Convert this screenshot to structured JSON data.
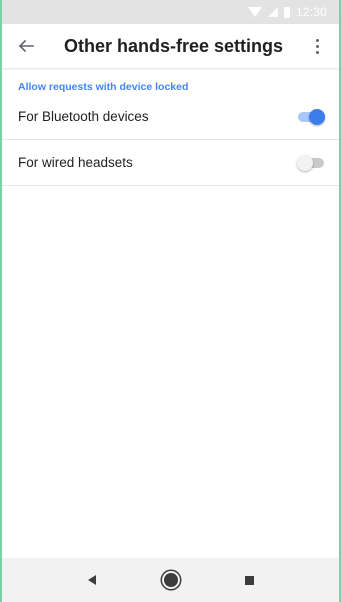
{
  "status_bar": {
    "time": "12:30",
    "icons": [
      "wifi-icon",
      "signal-icon",
      "battery-icon"
    ]
  },
  "app_bar": {
    "title": "Other hands-free settings",
    "back_icon": "arrow-back-icon",
    "more_icon": "more-vert-icon"
  },
  "section": {
    "header": "Allow requests with device locked",
    "items": [
      {
        "label": "For Bluetooth devices",
        "toggle_on": true
      },
      {
        "label": "For wired headsets",
        "toggle_on": false
      }
    ]
  },
  "nav_bar": {
    "icons": [
      "nav-back-icon",
      "nav-home-icon",
      "nav-recents-icon"
    ]
  },
  "colors": {
    "accent": "#4285f4",
    "toggle_on_thumb": "#3b7ded",
    "toggle_on_track": "#a8c7fa",
    "toggle_off_thumb": "#f2f2f2",
    "toggle_off_track": "#c9c9c9"
  }
}
